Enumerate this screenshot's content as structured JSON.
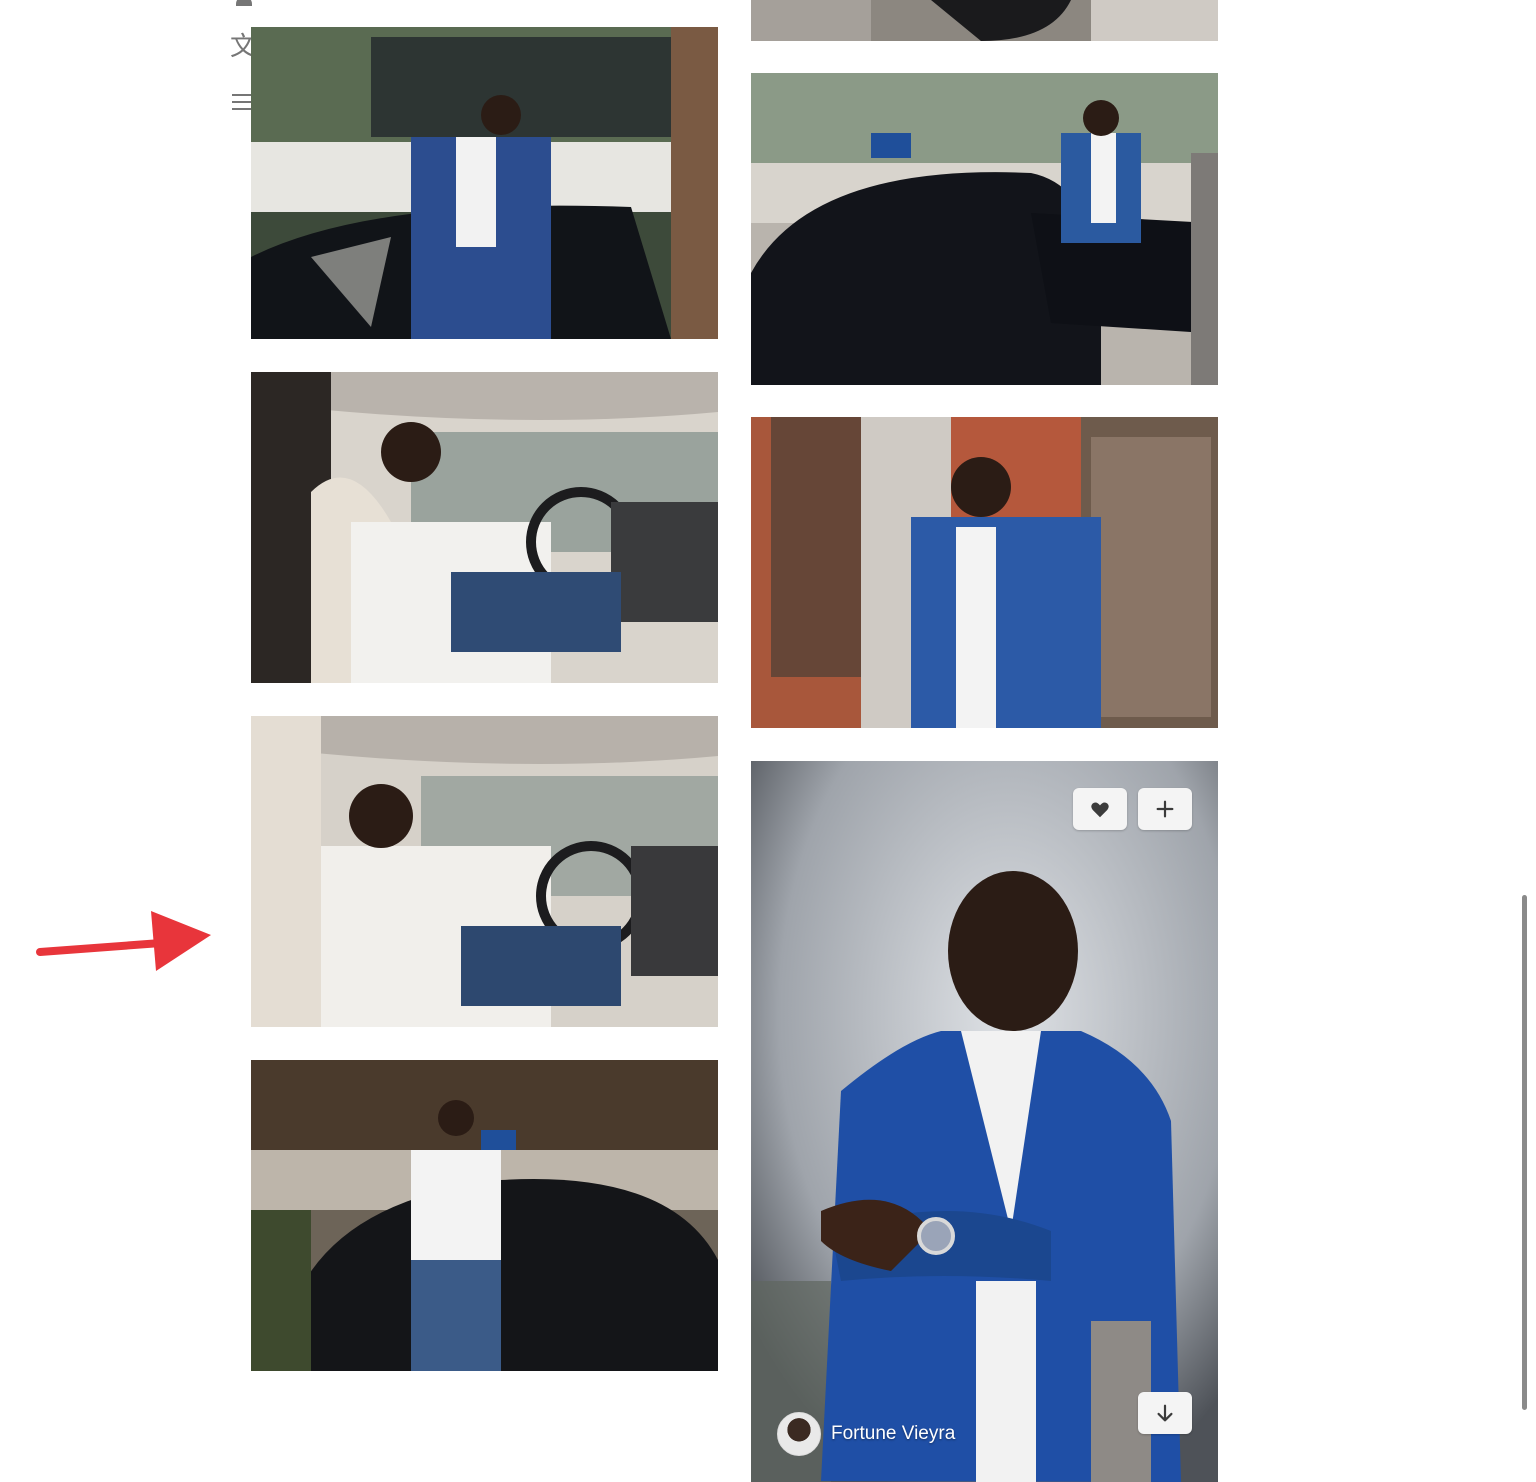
{
  "sidebar": {
    "user_icon": "user-icon",
    "language_icon_glyph": "文",
    "menu_icon": "hamburger-menu-icon"
  },
  "gallery": {
    "left_column": [
      {
        "name": "photo-man-blue-suit-beside-car",
        "alt": "Man in blue suit beside open car door"
      },
      {
        "name": "photo-man-driving-interior",
        "alt": "Man seated in car holding sunglasses"
      },
      {
        "name": "photo-man-driving-hand-on-chin",
        "alt": "Man seated in car with hand on chin"
      },
      {
        "name": "photo-man-sitting-on-car-hood",
        "alt": "Man sitting on front of car"
      }
    ],
    "right_column": [
      {
        "name": "photo-partial-top",
        "alt": "Partial photo"
      },
      {
        "name": "photo-man-opening-car-door",
        "alt": "Man opening car door on street"
      },
      {
        "name": "photo-man-brick-wall",
        "alt": "Man in blue blazer by brick wall"
      },
      {
        "name": "photo-man-portrait-arms-crossed",
        "alt": "Portrait of man with arms crossed"
      }
    ],
    "hovered_photo": {
      "author_name": "Fortune Vieyra",
      "like_icon": "heart-icon",
      "add_icon": "plus-icon",
      "download_icon": "download-arrow-icon"
    }
  },
  "colors": {
    "annotation_arrow": "#e8353b",
    "button_bg": "#f4f4f4",
    "sidebar_icon": "#767676"
  }
}
